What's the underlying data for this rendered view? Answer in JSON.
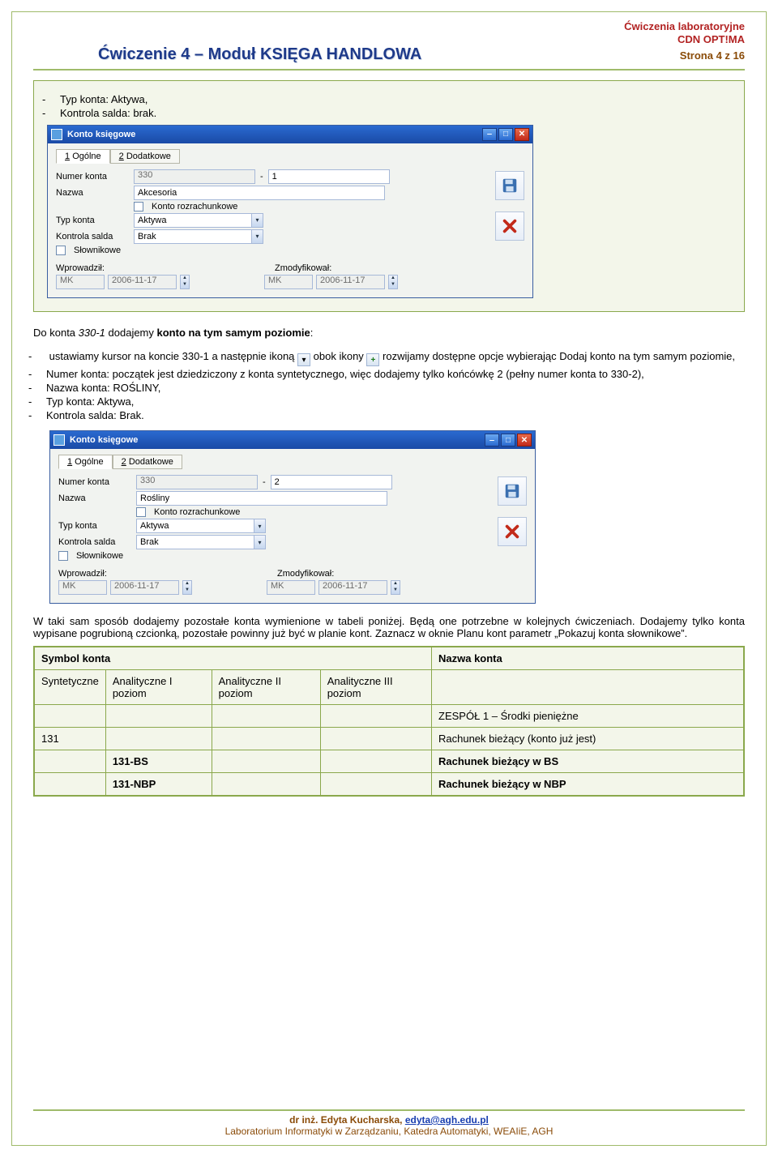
{
  "header": {
    "lab": "Ćwiczenia laboratoryjne",
    "app": "CDN OPT!MA",
    "title": "Ćwiczenie 4 – Moduł KSIĘGA HANDLOWA",
    "page": "Strona 4 z 16"
  },
  "intro_bullets": {
    "line1_label": "Typ konta: ",
    "line1_val": "Aktywa,",
    "line2_label": "Kontrola salda: ",
    "line2_val": "brak."
  },
  "dialog1": {
    "title": "Konto księgowe",
    "tab1": "1 Ogólne",
    "tab2": "2 Dodatkowe",
    "labels": {
      "numer": "Numer konta",
      "nazwa": "Nazwa",
      "rozr": "Konto rozrachunkowe",
      "typ": "Typ konta",
      "kontrola": "Kontrola salda",
      "slow": "Słownikowe",
      "wpro": "Wprowadził:",
      "zmod": "Zmodyfikował:"
    },
    "numer_parent": "330",
    "numer_sep": "-",
    "numer_suffix": "1",
    "nazwa_val": "Akcesoria",
    "typ_val": "Aktywa",
    "kontrola_val": "Brak",
    "user": "MK",
    "date": "2006-11-17"
  },
  "middle_text": {
    "lead": "Do konta 330-1 dodajemy konto na tym samym poziomie:",
    "b1a": "ustawiamy kursor na koncie 330-1 a następnie ikoną ",
    "b1b": " obok ikony ",
    "b1c": " rozwijamy dostępne opcje wybierając Dodaj konto na tym samym poziomie,",
    "b2": "Numer konta: początek jest dziedziczony z konta syntetycznego, więc dodajemy tylko końcówkę 2 (pełny numer konta to 330-2),",
    "b3": "Nazwa konta: ROŚLINY,",
    "b4": "Typ konta: Aktywa,",
    "b5": "Kontrola salda: Brak."
  },
  "dialog2": {
    "numer_parent": "330",
    "numer_suffix": "2",
    "nazwa_val": "Rośliny",
    "typ_val": "Aktywa",
    "kontrola_val": "Brak",
    "user": "MK",
    "date": "2006-11-17"
  },
  "para_after": "W taki sam sposób dodajemy pozostałe konta wymienione w tabeli poniżej. Będą one potrzebne w kolejnych ćwiczeniach. Dodajemy tylko konta wypisane pogrubioną czcionką, pozostałe powinny już być w planie kont. Zaznacz w oknie Planu kont parametr „Pokazuj konta słownikowe”.",
  "table": {
    "hdr_symbol": "Symbol konta",
    "hdr_nazwa": "Nazwa konta",
    "sub_synt": "Syntetyczne",
    "sub_a1": "Analityczne I poziom",
    "sub_a2": "Analityczne II poziom",
    "sub_a3": "Analityczne III poziom",
    "rows": [
      {
        "c0": "",
        "c1": "",
        "c2": "",
        "c3": "",
        "n": "ZESPÓŁ 1 – Środki pieniężne"
      },
      {
        "c0": "131",
        "c1": "",
        "c2": "",
        "c3": "",
        "n": "Rachunek bieżący (konto już jest)"
      },
      {
        "c0": "",
        "c1": "131-BS",
        "c2": "",
        "c3": "",
        "n": "Rachunek  bieżący  w BS"
      },
      {
        "c0": "",
        "c1": "131-NBP",
        "c2": "",
        "c3": "",
        "n": "Rachunek  bieżący  w NBP"
      }
    ]
  },
  "footer": {
    "line1a": "dr inż. Edyta Kucharska, ",
    "link": "edyta@agh.edu.pl",
    "line2": "Laboratorium Informatyki w Zarządzaniu, Katedra Automatyki, WEAIiE, AGH"
  }
}
